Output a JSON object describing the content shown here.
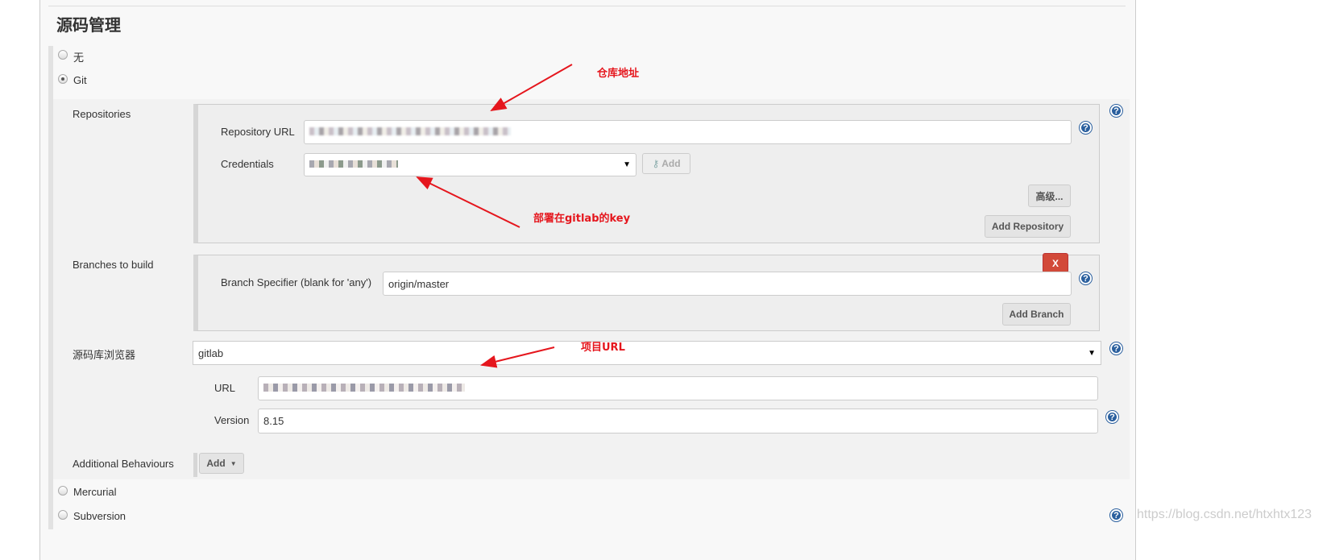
{
  "section_title": "源码管理",
  "scm_options": [
    {
      "label": "无",
      "selected": false
    },
    {
      "label": "Git",
      "selected": true
    },
    {
      "label": "Mercurial",
      "selected": false
    },
    {
      "label": "Subversion",
      "selected": false
    }
  ],
  "git": {
    "repositories_label": "Repositories",
    "repository_url_label": "Repository URL",
    "credentials_label": "Credentials",
    "credentials_add": "Add",
    "advanced_button": "高级...",
    "add_repository_button": "Add Repository",
    "branches_label": "Branches to build",
    "branch_specifier_label": "Branch Specifier (blank for 'any')",
    "branch_specifier_value": "origin/master",
    "delete_branch_button": "X",
    "add_branch_button": "Add Branch",
    "browser_label": "源码库浏览器",
    "browser_value": "gitlab",
    "url_label": "URL",
    "version_label": "Version",
    "version_value": "8.15",
    "additional_behaviours_label": "Additional Behaviours",
    "additional_add_button": "Add"
  },
  "annotations": {
    "repo_address": "仓库地址",
    "gitlab_key": "部署在gitlab的key",
    "project_url": "项目URL"
  },
  "watermark": "https://blog.csdn.net/htxhtx123",
  "colors": {
    "annotation": "#e5161d",
    "delete_button": "#d24939",
    "help_icon": "#2a5f9e"
  }
}
